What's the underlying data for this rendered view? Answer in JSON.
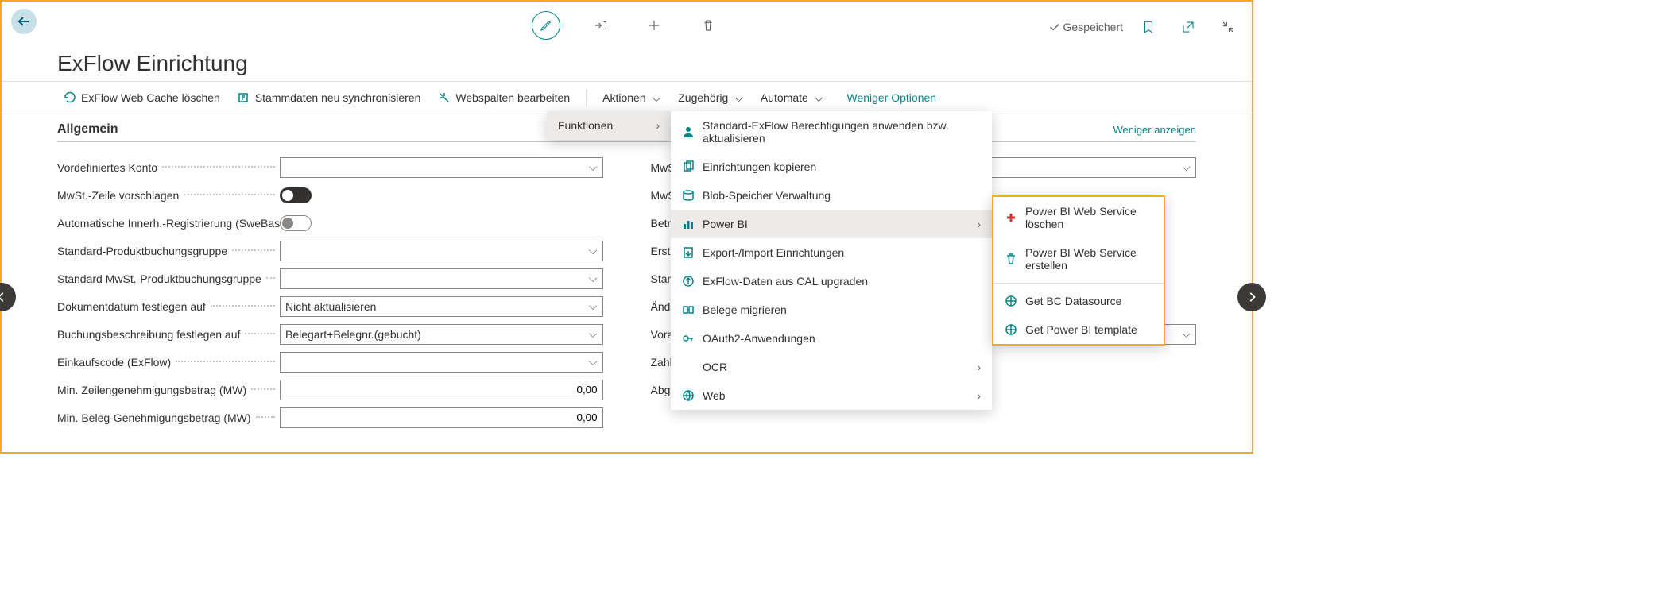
{
  "header": {
    "saved_label": "Gespeichert",
    "page_title": "ExFlow Einrichtung"
  },
  "actionbar": {
    "clear_cache": "ExFlow Web Cache löschen",
    "resync": "Stammdaten neu synchronisieren",
    "edit_cols": "Webspalten bearbeiten",
    "actions": "Aktionen",
    "related": "Zugehörig",
    "automate": "Automate",
    "fewer": "Weniger Optionen"
  },
  "section": {
    "title": "Allgemein",
    "show_less": "Weniger anzeigen"
  },
  "left_fields": {
    "predef_account": "Vordefiniertes Konto",
    "suggest_vat": "MwSt.-Zeile vorschlagen",
    "auto_innerh": "Automatische Innerh.-Registrierung (SweBase)",
    "std_prod_group": "Standard-Produktbuchungsgruppe",
    "std_vat_prod_group": "Standard MwSt.-Produktbuchungsgruppe",
    "doc_date": "Dokumentdatum festlegen auf",
    "doc_date_val": "Nicht aktualisieren",
    "posting_desc": "Buchungsbeschreibung festlegen auf",
    "posting_desc_val": "Belegart+Belegnr.(gebucht)",
    "purchase_code": "Einkaufscode (ExFlow)",
    "min_line": "Min. Zeilengenehmigungsbetrag (MW)",
    "min_line_val": "0,00",
    "min_doc": "Min. Beleg-Genehmigungsbetrag (MW)",
    "min_doc_val": "0,00"
  },
  "right_fields": {
    "vat_produ1": "MwSt.-Produ",
    "vat_produ2": "MwSt.-Produ",
    "betragsande": "Betragsände",
    "ersten_gene": "Ersten Genel",
    "standard_pr": "Standard Pr",
    "anderungen": "Änderungen",
    "vorauszahlu": "Vorauszahlu",
    "zahlungsube": "Zahlungsübe",
    "abgrenzung": "Abgrenzung nach vorne verschieben"
  },
  "menu1": {
    "funktionen": "Funktionen"
  },
  "menu2": {
    "standard_perm": "Standard-ExFlow Berechtigungen anwenden bzw. aktualisieren",
    "copy_setup": "Einrichtungen kopieren",
    "blob": "Blob-Speicher Verwaltung",
    "powerbi": "Power BI",
    "export_import": "Export-/Import Einrichtungen",
    "cal_upgrade": "ExFlow-Daten aus CAL upgraden",
    "migrate": "Belege migrieren",
    "oauth": "OAuth2-Anwendungen",
    "ocr": "OCR",
    "web": "Web"
  },
  "menu3": {
    "delete_ws": "Power BI Web Service löschen",
    "create_ws": "Power BI Web Service erstellen",
    "get_bc": "Get BC Datasource",
    "get_template": "Get Power BI template"
  }
}
